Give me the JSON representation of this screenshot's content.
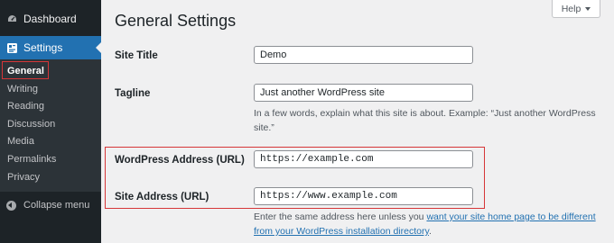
{
  "sidebar": {
    "dashboard_label": "Dashboard",
    "settings_label": "Settings",
    "submenu": [
      {
        "label": "General",
        "current": true
      },
      {
        "label": "Writing"
      },
      {
        "label": "Reading"
      },
      {
        "label": "Discussion"
      },
      {
        "label": "Media"
      },
      {
        "label": "Permalinks"
      },
      {
        "label": "Privacy"
      }
    ],
    "collapse_label": "Collapse menu"
  },
  "header": {
    "title": "General Settings",
    "help_label": "Help"
  },
  "form": {
    "site_title": {
      "label": "Site Title",
      "value": "Demo"
    },
    "tagline": {
      "label": "Tagline",
      "value": "Just another WordPress site",
      "description_line1": "In a few words, explain what this site is about. Example: “Just another WordPress",
      "description_line2": "site.”"
    },
    "wp_address": {
      "label": "WordPress Address (URL)",
      "value": "https://example.com"
    },
    "site_address": {
      "label": "Site Address (URL)",
      "value": "https://www.example.com",
      "description_prefix": "Enter the same address here unless you ",
      "description_link_line1": "want your site home page to be different",
      "description_link_line2": "from your WordPress installation directory",
      "description_suffix": "."
    }
  },
  "colors": {
    "sidebar_bg": "#1d2327",
    "active_menu": "#2271b1",
    "highlight_border": "#d63638",
    "link": "#2271b1"
  }
}
